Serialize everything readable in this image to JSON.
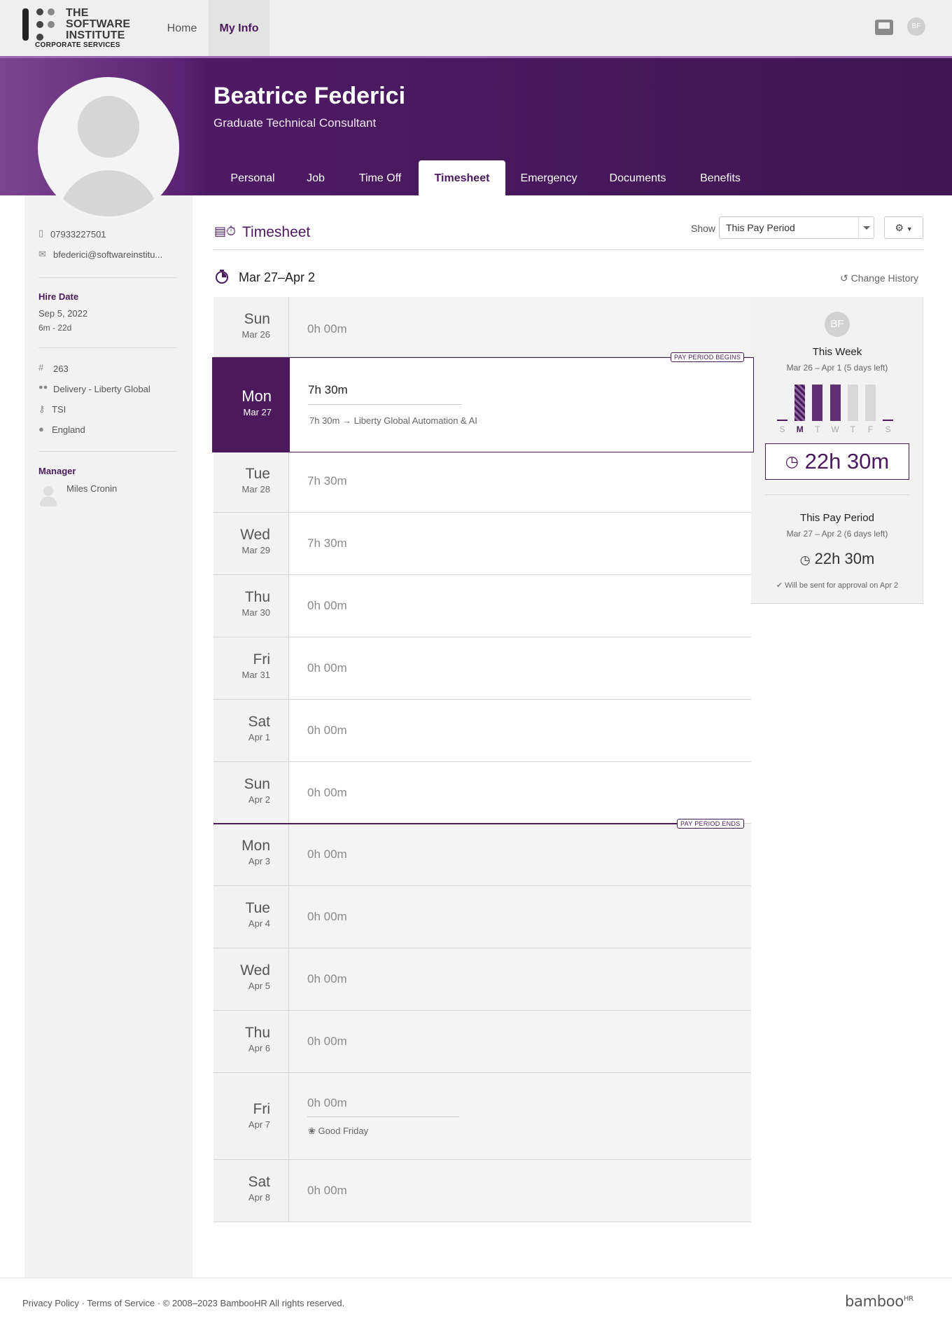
{
  "nav": {
    "logo_lines": [
      "THE",
      "SOFTWARE",
      "INSTITUTE",
      "CORPORATE SERVICES"
    ],
    "tabs": [
      {
        "label": "Home"
      },
      {
        "label": "My Info"
      }
    ],
    "user_initials": "BF"
  },
  "profile": {
    "name": "Beatrice Federici",
    "title": "Graduate Technical Consultant",
    "tabs": [
      {
        "label": "Personal"
      },
      {
        "label": "Job"
      },
      {
        "label": "Time Off"
      },
      {
        "label": "Timesheet",
        "active": true
      },
      {
        "label": "Emergency"
      },
      {
        "label": "Documents"
      },
      {
        "label": "Benefits"
      }
    ]
  },
  "sidebar": {
    "phone": "07933227501",
    "email": "bfederici@softwareinstitu...",
    "hire_date_label": "Hire Date",
    "hire_date": "Sep 5, 2022",
    "tenure": "6m - 22d",
    "employee_number": "263",
    "department": "Delivery - Liberty Global",
    "division": "TSI",
    "location": "England",
    "manager_label": "Manager",
    "manager_name": "Miles Cronin"
  },
  "timesheet": {
    "title": "Timesheet",
    "show_label": "Show",
    "show_value": "This Pay Period",
    "range": "Mar 27–Apr 2",
    "change_history": "Change History",
    "pay_period_begins": "PAY PERIOD BEGINS",
    "pay_period_ends": "PAY PERIOD ENDS",
    "days": [
      {
        "day": "Sun",
        "date": "Mar 26",
        "hours": "0h 00m"
      },
      {
        "day": "Mon",
        "date": "Mar 27",
        "hours": "7h 30m",
        "entry": "7h 30m → Liberty Global Automation & AI"
      },
      {
        "day": "Tue",
        "date": "Mar 28",
        "hours": "7h 30m"
      },
      {
        "day": "Wed",
        "date": "Mar 29",
        "hours": "7h 30m"
      },
      {
        "day": "Thu",
        "date": "Mar 30",
        "hours": "0h 00m"
      },
      {
        "day": "Fri",
        "date": "Mar 31",
        "hours": "0h 00m"
      },
      {
        "day": "Sat",
        "date": "Apr 1",
        "hours": "0h 00m"
      },
      {
        "day": "Sun",
        "date": "Apr 2",
        "hours": "0h 00m"
      },
      {
        "day": "Mon",
        "date": "Apr 3",
        "hours": "0h 00m"
      },
      {
        "day": "Tue",
        "date": "Apr 4",
        "hours": "0h 00m"
      },
      {
        "day": "Wed",
        "date": "Apr 5",
        "hours": "0h 00m"
      },
      {
        "day": "Thu",
        "date": "Apr 6",
        "hours": "0h 00m"
      },
      {
        "day": "Fri",
        "date": "Apr 7",
        "hours": "0h 00m",
        "holiday": "Good Friday"
      },
      {
        "day": "Sat",
        "date": "Apr 8",
        "hours": "0h 00m"
      }
    ]
  },
  "summary": {
    "initials": "BF",
    "week_title": "This Week",
    "week_range": "Mar 26 – Apr 1 (5 days left)",
    "week_total": "22h 30m",
    "week_bars": [
      {
        "label": "S",
        "hours": 0,
        "state": "empty"
      },
      {
        "label": "M",
        "hours": 7.5,
        "state": "today"
      },
      {
        "label": "T",
        "hours": 7.5,
        "state": "filled"
      },
      {
        "label": "W",
        "hours": 7.5,
        "state": "filled"
      },
      {
        "label": "T",
        "hours": 7.5,
        "state": "future"
      },
      {
        "label": "F",
        "hours": 7.5,
        "state": "future"
      },
      {
        "label": "S",
        "hours": 0,
        "state": "empty"
      }
    ],
    "period_title": "This Pay Period",
    "period_range": "Mar 27 – Apr 2 (6 days left)",
    "period_total": "22h 30m",
    "approval_note": "Will be sent for approval on Apr 2"
  },
  "footer": {
    "privacy": "Privacy Policy",
    "terms": "Terms of Service",
    "copyright": "© 2008–2023 BambooHR All rights reserved.",
    "brand": "bamboo",
    "brand_suffix": "HR"
  },
  "colors": {
    "brand": "#4a1a5c",
    "header_start": "#7b4590",
    "header_end": "#3f1553"
  }
}
